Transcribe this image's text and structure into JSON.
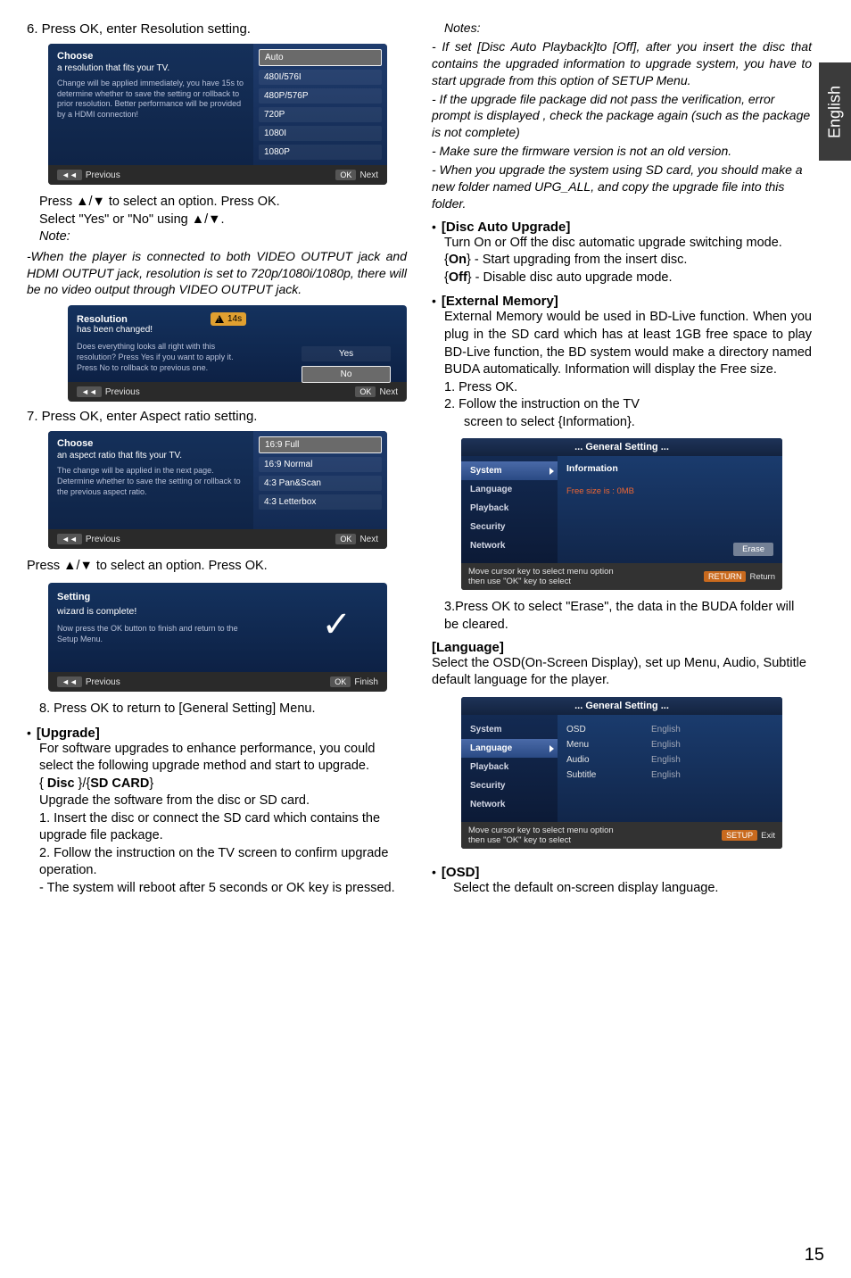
{
  "pageNumber": "15",
  "langTab": "English",
  "left": {
    "step6": "6. Press OK, enter Resolution setting.",
    "mock1": {
      "title": "Choose",
      "sub": "a resolution that fits your TV.",
      "desc": "Change will be applied immediately, you have 15s to determine whether to save the setting or rollback to prior resolution. Better performance will be provided by a HDMI connection!",
      "options": [
        "Auto",
        "480I/576I",
        "480P/576P",
        "720P",
        "1080I",
        "1080P"
      ],
      "prevLabel": "Previous",
      "nextLabel": "Next",
      "prevPill": "◄◄",
      "okPill": "OK"
    },
    "afterMock1a": "Press ▲/▼ to select an option. Press OK.",
    "afterMock1b": "Select \"Yes\" or \"No\" using ▲/▼.",
    "noteLabel": "Note:",
    "noteBody": "-When the player is connected to both VIDEO OUTPUT jack and HDMI OUTPUT jack, resolution is set to 720p/1080i/1080p, there will be no video output through VIDEO OUTPUT jack.",
    "mockTimer": {
      "title": "Resolution",
      "sub": "has been changed!",
      "timer": "14s",
      "desc": "Does everything looks all right with this resolution? Press Yes if you want to apply it. Press No to rollback to previous one.",
      "yes": "Yes",
      "no": "No",
      "prevLabel": "Previous",
      "nextLabel": "Next",
      "prevPill": "◄◄",
      "okPill": "OK"
    },
    "step7": "7. Press OK, enter Aspect ratio setting.",
    "mock2": {
      "title": "Choose",
      "sub": "an aspect ratio that fits your TV.",
      "desc": "The change will be applied in the next page. Determine whether to save the setting or rollback to the previous aspect ratio.",
      "options": [
        "16:9 Full",
        "16:9 Normal",
        "4:3 Pan&Scan",
        "4:3 Letterbox"
      ],
      "prevLabel": "Previous",
      "nextLabel": "Next",
      "prevPill": "◄◄",
      "okPill": "OK"
    },
    "afterMock2": "Press ▲/▼ to select an option. Press OK.",
    "mockCheck": {
      "title": "Setting",
      "sub": "wizard is complete!",
      "desc": "Now press the OK button to finish and return to the Setup Menu.",
      "prevLabel": "Previous",
      "finishLabel": "Finish",
      "prevPill": "◄◄",
      "okPill": "OK"
    },
    "step8": "8. Press OK to return to [General Setting] Menu.",
    "upgradeHead": "[Upgrade]",
    "upgradeBody": "For software upgrades to enhance performance, you could select the following upgrade method and start to upgrade.",
    "upgradeSource": "{ Disc }/{SD CARD}",
    "upgradeBody2": "Upgrade the software from the disc or SD card.",
    "upgradeS1": "1. Insert the disc or connect the SD card which contains the upgrade file package.",
    "upgradeS2": "2. Follow the instruction on the TV screen to confirm upgrade operation.",
    "upgradeS3": "- The system will reboot after 5 seconds or OK key is pressed."
  },
  "right": {
    "notesLabel": "Notes:",
    "n1": "- If set [Disc Auto Playback]to [Off], after you insert the disc that contains the upgraded information to upgrade system, you have to start upgrade from this option of SETUP Menu.",
    "n2": "- If the upgrade file package did not pass the verification, error prompt is displayed , check the package again (such as the package is not complete)",
    "n3": "- Make sure the firmware version is not an old version.",
    "n4": "- When you upgrade the system using SD card, you should make a new folder named UPG_ALL, and copy the upgrade file into this folder.",
    "discAutoHead": "[Disc Auto Upgrade]",
    "discAutoBody": "Turn On or Off the disc automatic upgrade switching mode.",
    "onLabel": "On",
    "onBody": " - Start upgrading from the insert disc.",
    "offLabel": "Off",
    "offBody": " - Disable disc auto upgrade mode.",
    "extMemHead": "[External Memory]",
    "extMemBody": "External Memory would be used in BD-Live function. When you plug in the SD card which has at least 1GB free space to play BD-Live function, the BD system would make a directory named BUDA automatically. Information will display the Free size.",
    "extS1": "1. Press OK.",
    "extS2": "2. Follow the instruction on the TV",
    "extS2b": "screen to select {Information}.",
    "gsMenu1": {
      "header": "... General Setting ...",
      "side": [
        "System",
        "Language",
        "Playback",
        "Security",
        "Network"
      ],
      "mainTitle": "Information",
      "freeText": "Free size is : 0MB",
      "erase": "Erase",
      "hint": "Move cursor key to select menu option",
      "hint2": "then use \"OK\" key to select",
      "returnPill": "RETURN",
      "returnText": "Return"
    },
    "afterMenu1": "3.Press OK to select \"Erase\", the data in the BUDA folder will be cleared.",
    "langHead": "[Language]",
    "langBody": "Select the OSD(On-Screen Display), set up Menu, Audio, Subtitle default language for the player.",
    "gsMenu2": {
      "header": "... General Setting ...",
      "side": [
        "System",
        "Language",
        "Playback",
        "Security",
        "Network"
      ],
      "rows": [
        {
          "k": "OSD",
          "v": "English"
        },
        {
          "k": "Menu",
          "v": "English"
        },
        {
          "k": "Audio",
          "v": "English"
        },
        {
          "k": "Subtitle",
          "v": "English"
        }
      ],
      "hint": "Move cursor key to select menu option",
      "hint2": "then use \"OK\" key to select",
      "exitPill": "SETUP",
      "exitText": "Exit"
    },
    "osdHead": "[OSD]",
    "osdBody": "Select the default on-screen display language."
  }
}
